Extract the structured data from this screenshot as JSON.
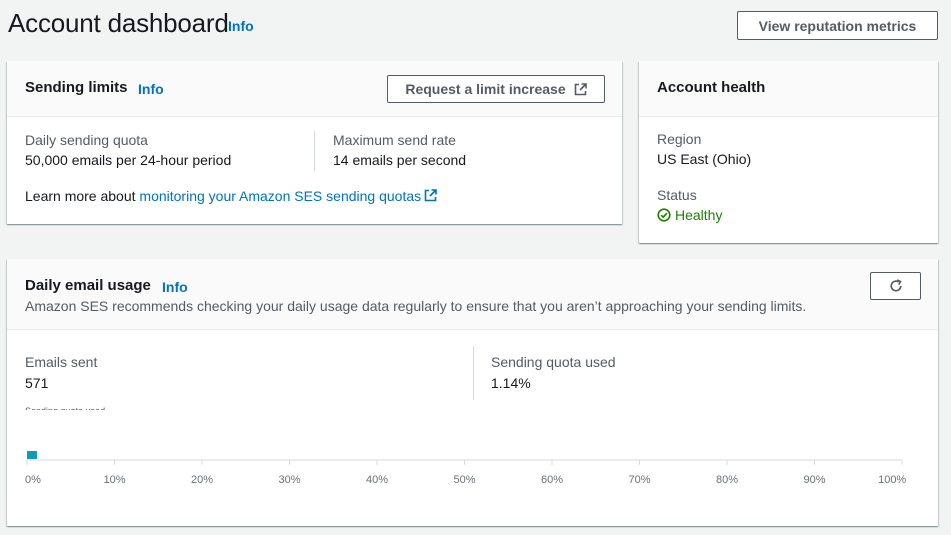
{
  "header": {
    "title": "Account dashboard",
    "info": "Info",
    "reputation_button": "View reputation metrics"
  },
  "sending_limits": {
    "title": "Sending limits",
    "info": "Info",
    "request_button": "Request a limit increase",
    "daily_quota_label": "Daily sending quota",
    "daily_quota_value": "50,000 emails per 24-hour period",
    "max_rate_label": "Maximum send rate",
    "max_rate_value": "14 emails per second",
    "learn_prefix": "Learn more about ",
    "learn_link": "monitoring your Amazon SES sending quotas"
  },
  "account_health": {
    "title": "Account health",
    "region_label": "Region",
    "region_value": "US East (Ohio)",
    "status_label": "Status",
    "status_value": "Healthy",
    "status_color": "#1d8102"
  },
  "daily_usage": {
    "title": "Daily email usage",
    "info": "Info",
    "description": "Amazon SES recommends checking your daily usage data regularly to ensure that you aren’t approaching your sending limits.",
    "emails_sent_label": "Emails sent",
    "emails_sent_value": "571",
    "quota_used_label": "Sending quota used",
    "quota_used_value": "1.14%",
    "quota_used_fraction": 0.0114,
    "bar_color": "#0f9bb7",
    "clipped_label": "Sending quota used",
    "ticks": [
      "0%",
      "10%",
      "20%",
      "30%",
      "40%",
      "50%",
      "60%",
      "70%",
      "80%",
      "90%",
      "100%"
    ]
  },
  "colors": {
    "link": "#0073bb",
    "text": "#16191f",
    "muted": "#545b64",
    "background": "#f2f3f3"
  }
}
